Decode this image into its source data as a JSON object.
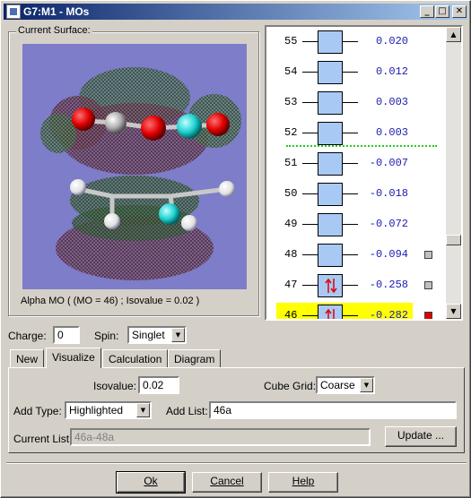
{
  "window": {
    "title": "G7:M1 - MOs",
    "minimize_glyph": "_",
    "maximize_glyph": "□",
    "close_glyph": "✕"
  },
  "surface": {
    "group_label": "Current Surface:",
    "caption": "Alpha MO  ( (MO = 46)  ;  Isovalue = 0.02 )"
  },
  "mo_list": {
    "rows": [
      {
        "num": "55",
        "energy": "0.020",
        "occupied": false,
        "square": ""
      },
      {
        "num": "54",
        "energy": "0.012",
        "occupied": false,
        "square": ""
      },
      {
        "num": "53",
        "energy": "0.003",
        "occupied": false,
        "square": ""
      },
      {
        "num": "52",
        "energy": "0.003",
        "occupied": false,
        "square": ""
      },
      {
        "num": "51",
        "energy": "-0.007",
        "occupied": false,
        "square": ""
      },
      {
        "num": "50",
        "energy": "-0.018",
        "occupied": false,
        "square": ""
      },
      {
        "num": "49",
        "energy": "-0.072",
        "occupied": false,
        "square": ""
      },
      {
        "num": "48",
        "energy": "-0.094",
        "occupied": false,
        "square": "gray"
      },
      {
        "num": "47",
        "energy": "-0.258",
        "occupied": true,
        "square": "gray"
      },
      {
        "num": "46",
        "energy": "-0.282",
        "occupied": true,
        "square": "red",
        "selected": true
      }
    ],
    "colors": {
      "highlight": "#ffff00",
      "separator": "#22cc22",
      "box": "#a9c9f5",
      "energy": "#1a1ab3",
      "spin_arrows": "#e00000",
      "square_gray": "#c0c0c0",
      "square_red": "#e00000"
    }
  },
  "controls": {
    "charge_label": "Charge:",
    "charge_value": "0",
    "spin_label": "Spin:",
    "spin_value": "Singlet"
  },
  "tabs": [
    {
      "label": "New",
      "active": false
    },
    {
      "label": "Visualize",
      "active": true
    },
    {
      "label": "Calculation",
      "active": false
    },
    {
      "label": "Diagram",
      "active": false
    }
  ],
  "visualize": {
    "isovalue_label": "Isovalue:",
    "isovalue_value": "0.02",
    "cube_grid_label": "Cube Grid:",
    "cube_grid_value": "Coarse",
    "add_type_label": "Add Type:",
    "add_type_value": "Highlighted",
    "add_list_label": "Add List:",
    "add_list_value": "46a",
    "current_list_label": "Current List:",
    "current_list_value": "46a-48a",
    "update_label": "Update ..."
  },
  "buttons": {
    "ok": "Ok",
    "cancel": "Cancel",
    "help": "Help"
  }
}
